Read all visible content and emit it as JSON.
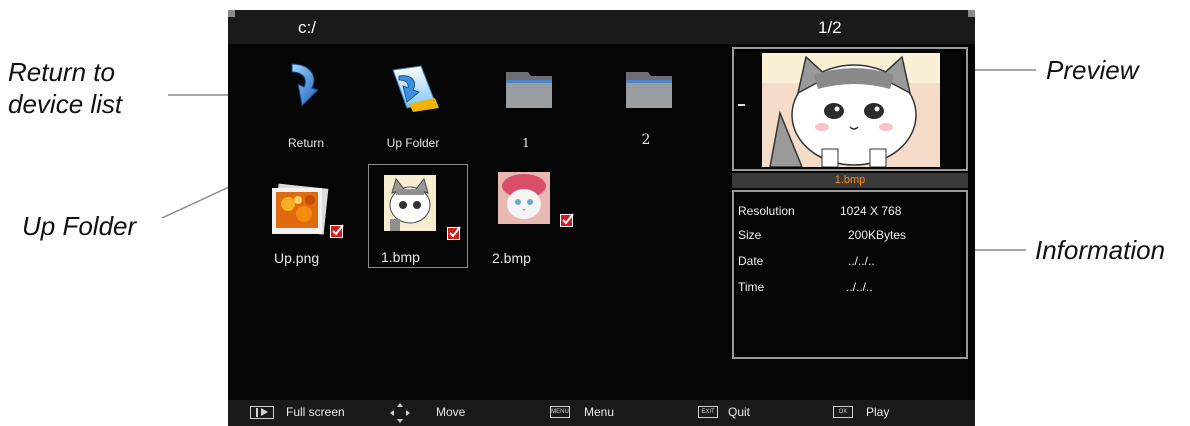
{
  "callouts": {
    "return_line1": "Return to",
    "return_line2": "device list",
    "up_folder": "Up Folder",
    "preview": "Preview",
    "information": "Information"
  },
  "header": {
    "path": "c:/",
    "page": "1/2"
  },
  "grid": {
    "items": [
      {
        "label": "Return",
        "icon": "return-arrow-icon"
      },
      {
        "label": "Up Folder",
        "icon": "up-folder-icon"
      },
      {
        "label": "1",
        "icon": "folder-icon"
      },
      {
        "label": "2",
        "icon": "folder-icon"
      },
      {
        "label": "Up.png",
        "icon": "image-thumbnail",
        "checked": true
      },
      {
        "label": "1.bmp",
        "icon": "image-thumbnail",
        "checked": true,
        "selected": true
      },
      {
        "label": "2.bmp",
        "icon": "image-thumbnail",
        "checked": true
      }
    ]
  },
  "preview": {
    "filename": "1.bmp"
  },
  "info": {
    "resolution_label": "Resolution",
    "resolution_value": "1024 X 768",
    "size_label": "Size",
    "size_value": "200KBytes",
    "date_label": "Date",
    "date_value": "../../..",
    "time_label": "Time",
    "time_value": "../../.."
  },
  "footer": {
    "fullscreen": "Full screen",
    "move": "Move",
    "menu": "Menu",
    "menu_key": "MENU",
    "quit": "Quit",
    "quit_key": "EXIT",
    "play": "Play",
    "play_key": "OK"
  },
  "colors": {
    "screen_bg": "#050505",
    "bar_bg": "#1a1a1a",
    "filename_accent": "#ff8c1a",
    "check_red": "#d21b1b"
  }
}
